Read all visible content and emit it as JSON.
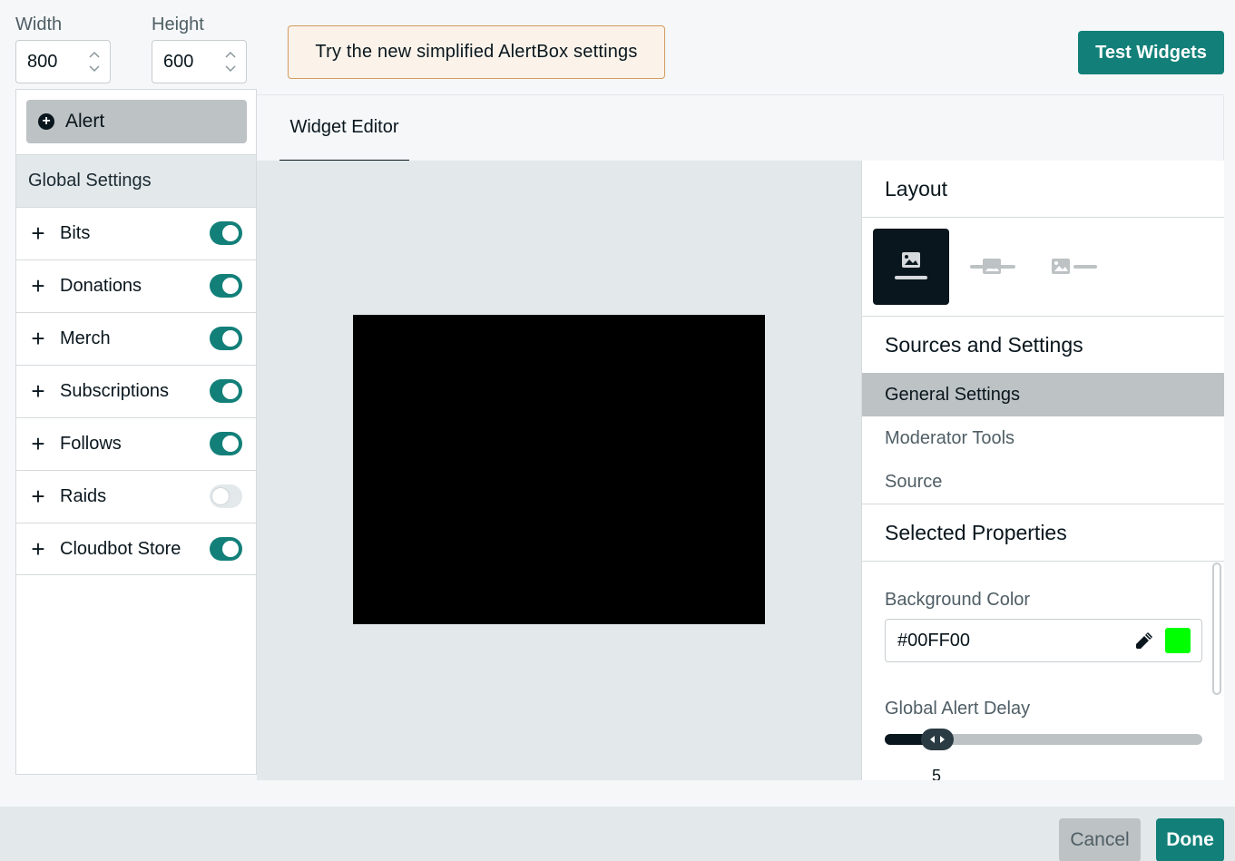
{
  "dimensions": {
    "width_label": "Width",
    "width_value": "800",
    "height_label": "Height",
    "height_value": "600"
  },
  "promo_text": "Try the new simplified AlertBox settings",
  "test_widgets_label": "Test Widgets",
  "sidebar": {
    "alert_button": "Alert",
    "global_settings": "Global Settings",
    "items": [
      {
        "label": "Bits",
        "enabled": true
      },
      {
        "label": "Donations",
        "enabled": true
      },
      {
        "label": "Merch",
        "enabled": true
      },
      {
        "label": "Subscriptions",
        "enabled": true
      },
      {
        "label": "Follows",
        "enabled": true
      },
      {
        "label": "Raids",
        "enabled": false
      },
      {
        "label": "Cloudbot Store",
        "enabled": true
      }
    ]
  },
  "editor": {
    "tab_label": "Widget Editor",
    "preview_background": "#000000"
  },
  "right_panel": {
    "layout_title": "Layout",
    "sources_title": "Sources and Settings",
    "menu": [
      "General Settings",
      "Moderator Tools",
      "Source"
    ],
    "active_menu": "General Settings",
    "selected_title": "Selected Properties",
    "background_color_label": "Background Color",
    "background_color_value": "#00FF00",
    "alert_delay_label": "Global Alert Delay",
    "alert_delay_value": "5"
  },
  "footer": {
    "cancel_label": "Cancel",
    "done_label": "Done"
  },
  "colors": {
    "accent": "#128079",
    "dark": "#09161d",
    "swatch": "#00ff00"
  }
}
